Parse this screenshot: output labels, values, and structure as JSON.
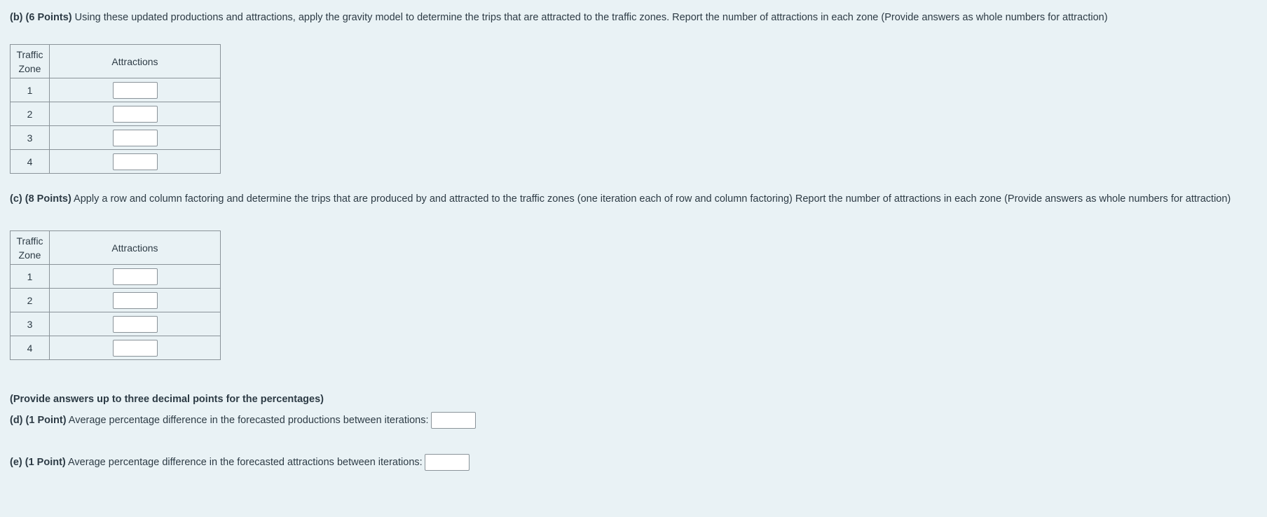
{
  "part_b": {
    "label": "(b) (6 Points)",
    "text": "Using these updated productions and attractions, apply the gravity model to determine the trips that are attracted to the traffic zones. Report the number of attractions in each zone (Provide answers as whole numbers for attraction)",
    "table": {
      "headers": [
        "Traffic Zone",
        "Attractions"
      ],
      "rows": [
        {
          "zone": "1",
          "value": ""
        },
        {
          "zone": "2",
          "value": ""
        },
        {
          "zone": "3",
          "value": ""
        },
        {
          "zone": "4",
          "value": ""
        }
      ]
    }
  },
  "part_c": {
    "label": "(c) (8 Points)",
    "text": "Apply a row and column factoring and determine the trips that are produced by and attracted to the traffic zones (one iteration each of row and column factoring) Report the number of attractions in each zone (Provide answers as whole numbers for attraction)",
    "table": {
      "headers": [
        "Traffic Zone",
        "Attractions"
      ],
      "rows": [
        {
          "zone": "1",
          "value": ""
        },
        {
          "zone": "2",
          "value": ""
        },
        {
          "zone": "3",
          "value": ""
        },
        {
          "zone": "4",
          "value": ""
        }
      ]
    }
  },
  "note": "(Provide answers up to three decimal points for the percentages)",
  "part_d": {
    "label": "(d) (1 Point)",
    "text": "Average percentage difference in the forecasted productions between iterations:",
    "value": ""
  },
  "part_e": {
    "label": "(e) (1 Point)",
    "text": "Average percentage difference in the forecasted attractions between iterations:",
    "value": ""
  }
}
